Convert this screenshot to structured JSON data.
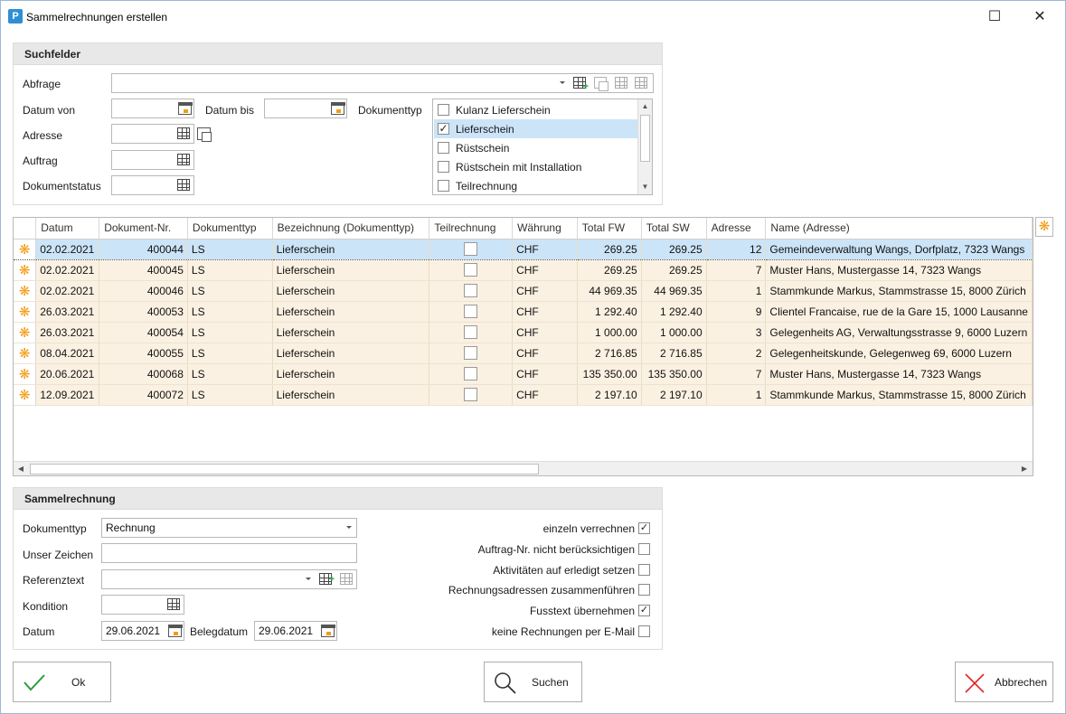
{
  "window": {
    "title": "Sammelrechnungen erstellen",
    "app_icon": "P",
    "maximize_glyph": "☐",
    "close_glyph": "✕"
  },
  "search": {
    "header": "Suchfelder",
    "abfrage_label": "Abfrage",
    "abfrage_value": "",
    "datum_von_label": "Datum von",
    "datum_von_value": "",
    "datum_bis_label": "Datum bis",
    "datum_bis_value": "",
    "dokumenttyp_label": "Dokumenttyp",
    "adresse_label": "Adresse",
    "adresse_value": "",
    "auftrag_label": "Auftrag",
    "auftrag_value": "",
    "dokumentstatus_label": "Dokumentstatus",
    "dokumentstatus_value": "",
    "doc_types": [
      {
        "label": "Kulanz Lieferschein",
        "checked": false
      },
      {
        "label": "Lieferschein",
        "checked": true
      },
      {
        "label": "Rüstschein",
        "checked": false
      },
      {
        "label": "Rüstschein mit Installation",
        "checked": false
      },
      {
        "label": "Teilrechnung",
        "checked": false
      }
    ]
  },
  "grid": {
    "columns": [
      "Datum",
      "Dokument-Nr.",
      "Dokumenttyp",
      "Bezeichnung (Dokumenttyp)",
      "Teilrechnung",
      "Währung",
      "Total FW",
      "Total SW",
      "Adresse",
      "Name (Adresse)"
    ],
    "row_indicator": "❋",
    "rows": [
      {
        "datum": "02.02.2021",
        "nr": "400044",
        "typ": "LS",
        "bez": "Lieferschein",
        "teil": false,
        "waehrung": "CHF",
        "fw": "269.25",
        "sw": "269.25",
        "adresse": "12",
        "name": "Gemeindeverwaltung Wangs, Dorfplatz, 7323 Wangs",
        "selected": true
      },
      {
        "datum": "02.02.2021",
        "nr": "400045",
        "typ": "LS",
        "bez": "Lieferschein",
        "teil": false,
        "waehrung": "CHF",
        "fw": "269.25",
        "sw": "269.25",
        "adresse": "7",
        "name": "Muster Hans, Mustergasse 14, 7323 Wangs"
      },
      {
        "datum": "02.02.2021",
        "nr": "400046",
        "typ": "LS",
        "bez": "Lieferschein",
        "teil": false,
        "waehrung": "CHF",
        "fw": "44 969.35",
        "sw": "44 969.35",
        "adresse": "1",
        "name": "Stammkunde Markus, Stammstrasse 15, 8000 Zürich"
      },
      {
        "datum": "26.03.2021",
        "nr": "400053",
        "typ": "LS",
        "bez": "Lieferschein",
        "teil": false,
        "waehrung": "CHF",
        "fw": "1 292.40",
        "sw": "1 292.40",
        "adresse": "9",
        "name": "Clientel Francaise, rue de la Gare 15, 1000 Lausanne"
      },
      {
        "datum": "26.03.2021",
        "nr": "400054",
        "typ": "LS",
        "bez": "Lieferschein",
        "teil": false,
        "waehrung": "CHF",
        "fw": "1 000.00",
        "sw": "1 000.00",
        "adresse": "3",
        "name": "Gelegenheits AG, Verwaltungsstrasse 9, 6000 Luzern"
      },
      {
        "datum": "08.04.2021",
        "nr": "400055",
        "typ": "LS",
        "bez": "Lieferschein",
        "teil": false,
        "waehrung": "CHF",
        "fw": "2 716.85",
        "sw": "2 716.85",
        "adresse": "2",
        "name": "Gelegenheitskunde, Gelegenweg 69, 6000 Luzern"
      },
      {
        "datum": "20.06.2021",
        "nr": "400068",
        "typ": "LS",
        "bez": "Lieferschein",
        "teil": false,
        "waehrung": "CHF",
        "fw": "135 350.00",
        "sw": "135 350.00",
        "adresse": "7",
        "name": "Muster Hans, Mustergasse 14, 7323 Wangs"
      },
      {
        "datum": "12.09.2021",
        "nr": "400072",
        "typ": "LS",
        "bez": "Lieferschein",
        "teil": false,
        "waehrung": "CHF",
        "fw": "2 197.10",
        "sw": "2 197.10",
        "adresse": "1",
        "name": "Stammkunde Markus, Stammstrasse 15, 8000 Zürich"
      }
    ]
  },
  "sammel": {
    "header": "Sammelrechnung",
    "dokumenttyp_label": "Dokumenttyp",
    "dokumenttyp_value": "Rechnung",
    "unser_zeichen_label": "Unser Zeichen",
    "unser_zeichen_value": "",
    "referenztext_label": "Referenztext",
    "referenztext_value": "",
    "kondition_label": "Kondition",
    "kondition_value": "",
    "datum_label": "Datum",
    "datum_value": "29.06.2021",
    "belegdatum_label": "Belegdatum",
    "belegdatum_value": "29.06.2021",
    "options": [
      {
        "label": "einzeln verrechnen",
        "checked": true
      },
      {
        "label": "Auftrag-Nr. nicht berücksichtigen",
        "checked": false
      },
      {
        "label": "Aktivitäten auf erledigt setzen",
        "checked": false
      },
      {
        "label": "Rechnungsadressen zusammenführen",
        "checked": false
      },
      {
        "label": "Fusstext übernehmen",
        "checked": true
      },
      {
        "label": "keine Rechnungen per E-Mail",
        "checked": false
      }
    ]
  },
  "buttons": {
    "ok": "Ok",
    "suchen": "Suchen",
    "abbrechen": "Abbrechen"
  },
  "colors": {
    "accent": "#2e8fd4",
    "row_bg": "#fbf1e2",
    "selected_bg": "#cce4f7",
    "indicator": "#f39c12",
    "ok_check": "#2a9d3a",
    "cancel_x": "#e02424"
  },
  "check_glyph": "✓"
}
